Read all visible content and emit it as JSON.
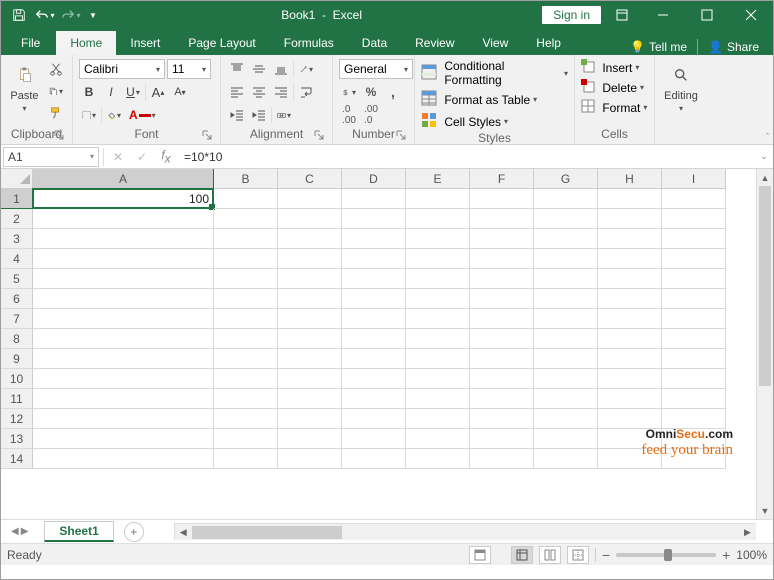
{
  "title": {
    "doc": "Book1",
    "app": "Excel",
    "signin": "Sign in"
  },
  "tabs": {
    "file": "File",
    "home": "Home",
    "insert": "Insert",
    "pagelayout": "Page Layout",
    "formulas": "Formulas",
    "data": "Data",
    "review": "Review",
    "view": "View",
    "help": "Help",
    "tellme": "Tell me",
    "share": "Share"
  },
  "ribbon": {
    "clipboard": {
      "label": "Clipboard",
      "paste": "Paste"
    },
    "font": {
      "label": "Font",
      "name": "Calibri",
      "size": "11"
    },
    "alignment": {
      "label": "Alignment"
    },
    "number": {
      "label": "Number",
      "format": "General"
    },
    "styles": {
      "label": "Styles",
      "cond": "Conditional Formatting",
      "table": "Format as Table",
      "cell": "Cell Styles"
    },
    "cells": {
      "label": "Cells",
      "insert": "Insert",
      "delete": "Delete",
      "format": "Format"
    },
    "editing": {
      "label": "Editing"
    }
  },
  "formulabar": {
    "cellref": "A1",
    "formula": "=10*10"
  },
  "grid": {
    "columns": [
      "A",
      "B",
      "C",
      "D",
      "E",
      "F",
      "G",
      "H",
      "I"
    ],
    "rows": [
      "1",
      "2",
      "3",
      "4",
      "5",
      "6",
      "7",
      "8",
      "9",
      "10",
      "11",
      "12",
      "13",
      "14"
    ],
    "a1_value": "100",
    "selected": "A1"
  },
  "sheet": {
    "name": "Sheet1"
  },
  "status": {
    "ready": "Ready",
    "zoom": "100%"
  },
  "watermark": {
    "brand1": "Omni",
    "brand2": "Secu",
    "brand3": ".com",
    "tagline": "feed your brain"
  }
}
